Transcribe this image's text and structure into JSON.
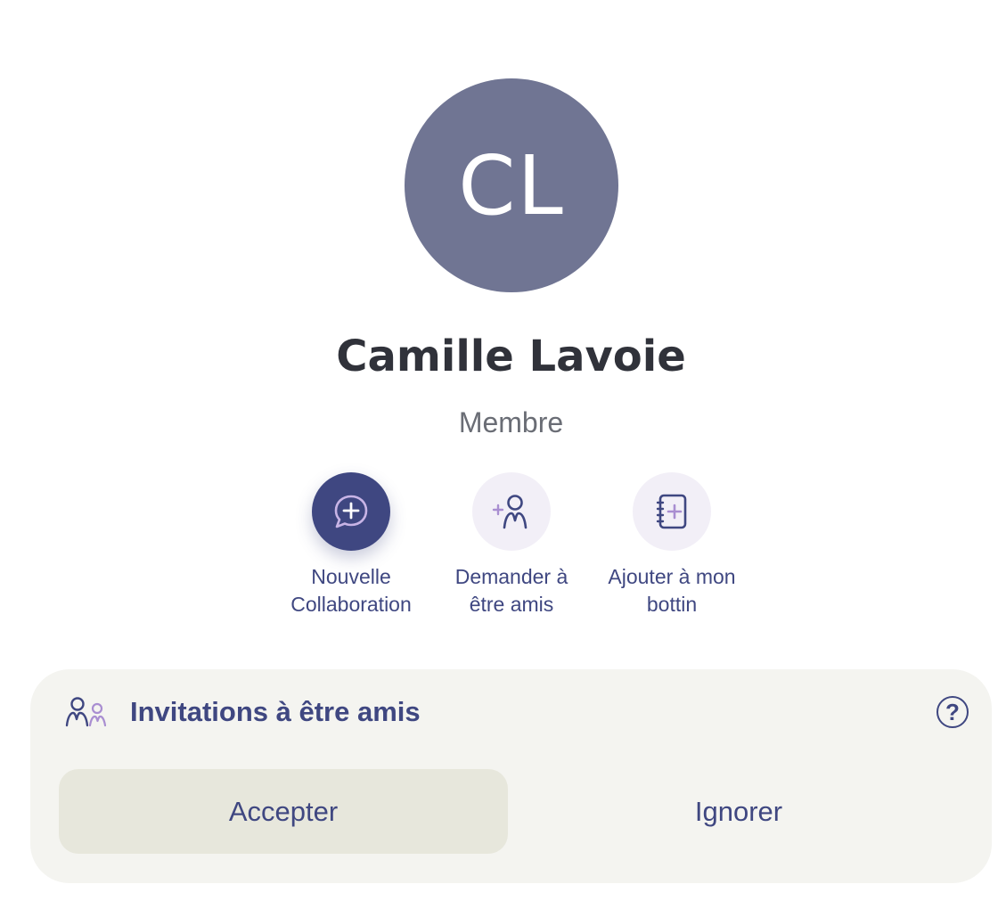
{
  "profile": {
    "initials": "CL",
    "name": "Camille Lavoie",
    "role": "Membre",
    "avatar_color": "#707593"
  },
  "actions": [
    {
      "label": "Nouvelle\nCollaboration",
      "icon": "chat-plus-icon"
    },
    {
      "label": "Demander à\nêtre amis",
      "icon": "add-friend-icon"
    },
    {
      "label": "Ajouter à mon\nbottin",
      "icon": "address-book-add-icon"
    }
  ],
  "invitations": {
    "title": "Invitations à être amis",
    "icon": "friends-icon",
    "help_icon": "help-icon",
    "help_glyph": "?",
    "accept_label": "Accepter",
    "ignore_label": "Ignorer"
  },
  "colors": {
    "accent": "#3f4781",
    "card_bg": "#f4f4f0",
    "accept_bg": "#e7e7dc",
    "action_bg": "#f2eff7"
  }
}
